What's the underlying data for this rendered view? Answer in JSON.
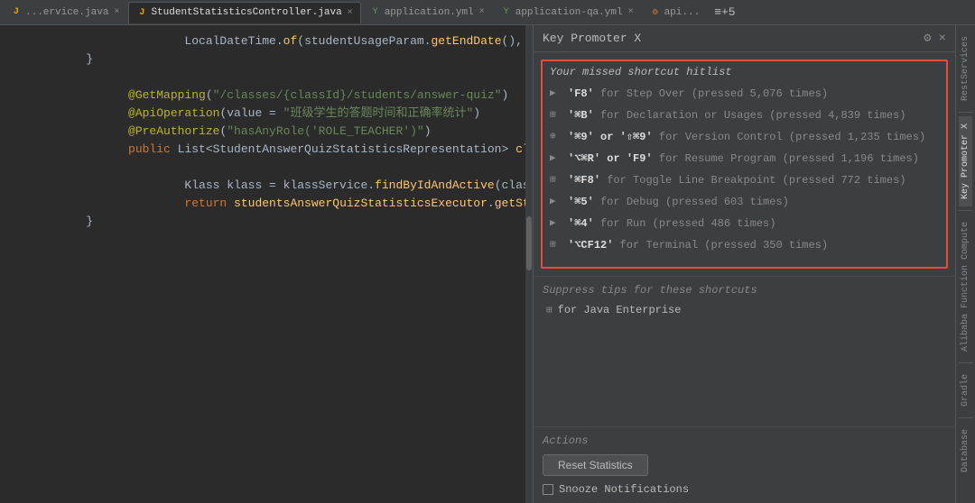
{
  "tabs": [
    {
      "label": "...ervice.java",
      "type": "java",
      "active": false
    },
    {
      "label": "StudentStatisticsController.java",
      "type": "java",
      "active": true
    },
    {
      "label": "application.yml",
      "type": "yml",
      "active": false
    },
    {
      "label": "application-qa.yml",
      "type": "yml",
      "active": false
    },
    {
      "label": "api...",
      "type": "api",
      "active": false
    },
    {
      "label": "≡+5",
      "type": "overflow",
      "active": false
    }
  ],
  "code_lines": [
    {
      "num": "",
      "text": "LocalDateTime.of(studentUsageParam.getEndDate(), Lo",
      "type": "mixed"
    },
    {
      "num": "",
      "text": "}",
      "type": "plain"
    },
    {
      "num": "",
      "text": "",
      "type": "blank"
    },
    {
      "num": "",
      "text": "@GetMapping(\"/classes/{classId}/students/answer-quiz\")",
      "type": "annotation"
    },
    {
      "num": "",
      "text": "@ApiOperation(value = \"班级学生的答题时间和正确率统计\")",
      "type": "annotation"
    },
    {
      "num": "",
      "text": "@PreAuthorize(\"hasAnyRole('ROLE_TEACHER')\")",
      "type": "annotation"
    },
    {
      "num": "",
      "text": "public List<StudentAnswerQuizStatisticsRepresentation> classStu",
      "type": "method"
    },
    {
      "num": "",
      "text": "",
      "type": "blank"
    },
    {
      "num": "",
      "text": "    Klass klass = klassService.findByIdAndActive(classId,  active",
      "type": "code"
    },
    {
      "num": "",
      "text": "    return studentsAnswerQuizStatisticsExecutor.getStudentQuizS",
      "type": "code"
    },
    {
      "num": "",
      "text": "}",
      "type": "plain"
    }
  ],
  "panel": {
    "title": "Key Promoter X",
    "hitlist_header": "Your missed shortcut hitlist",
    "shortcuts": [
      {
        "icon": "▶",
        "key": "'F8'",
        "desc": "for Step Over",
        "count": "pressed 5,076 times"
      },
      {
        "icon": "⊞",
        "key": "'⌘B'",
        "desc": "for Declaration or Usages",
        "count": "pressed 4,839 times"
      },
      {
        "icon": "⊕",
        "key": "'⌘9' or '⇧⌘9'",
        "desc": "for Version Control",
        "count": "pressed 1,235 times"
      },
      {
        "icon": "▶",
        "key": "'⌥⌘R' or 'F9'",
        "desc": "for Resume Program",
        "count": "pressed 1,196 times"
      },
      {
        "icon": "⊞",
        "key": "'⌘F8'",
        "desc": "for Toggle Line Breakpoint",
        "count": "pressed 772 times"
      },
      {
        "icon": "▶",
        "key": "'⌘5'",
        "desc": "for Debug",
        "count": "pressed 603 times"
      },
      {
        "icon": "▶",
        "key": "'⌘4'",
        "desc": "for Run",
        "count": "pressed 486 times"
      },
      {
        "icon": "⊞",
        "key": "'⌥CF12'",
        "desc": "for Terminal",
        "count": "pressed 350 times"
      }
    ],
    "suppress_label": "Suppress tips for these shortcuts",
    "suppress_items": [
      {
        "icon": "⊞",
        "label": "for Java Enterprise"
      }
    ],
    "actions_label": "Actions",
    "reset_btn": "Reset Statistics",
    "snooze_label": "Snooze Notifications"
  },
  "toolwindows": [
    {
      "label": "RestServices",
      "active": false
    },
    {
      "label": "Key Promoter X",
      "active": true
    },
    {
      "label": "Alibaba Function Compute",
      "active": false
    },
    {
      "label": "Gradle",
      "active": false
    },
    {
      "label": "Database",
      "active": false
    }
  ]
}
